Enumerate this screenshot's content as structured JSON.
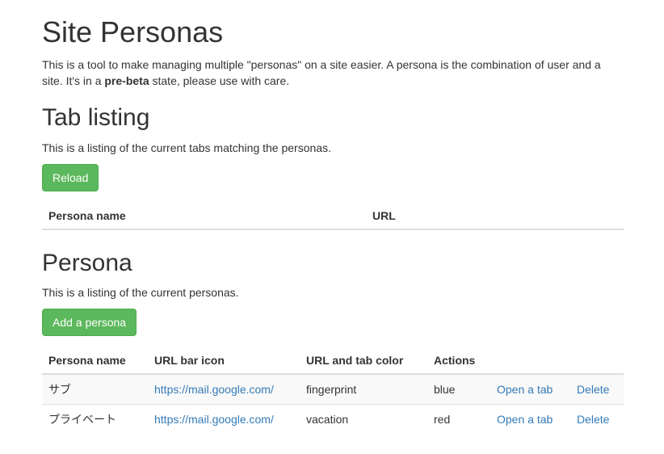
{
  "page": {
    "title": "Site Personas",
    "intro_text_1": "This is a tool to make managing multiple \"personas\" on a site easier. A persona is the combination of user and a site. It's in a ",
    "intro_bold": "pre-beta",
    "intro_text_2": " state, please use with care."
  },
  "tab_listing": {
    "heading": "Tab listing",
    "description": "This is a listing of the current tabs matching the personas.",
    "reload_label": "Reload",
    "columns": [
      "Persona name",
      "URL"
    ]
  },
  "persona": {
    "heading": "Persona",
    "description": "This is a listing of the current personas.",
    "add_label": "Add a persona",
    "columns": [
      "Persona name",
      "URL bar icon",
      "URL and tab color",
      "Actions"
    ],
    "rows": [
      {
        "name": "サブ",
        "url": "https://mail.google.com/",
        "icon": "fingerprint",
        "color": "blue",
        "open_label": "Open a tab",
        "delete_label": "Delete"
      },
      {
        "name": "プライベート",
        "url": "https://mail.google.com/",
        "icon": "vacation",
        "color": "red",
        "open_label": "Open a tab",
        "delete_label": "Delete"
      }
    ]
  },
  "colors": {
    "success": "#5cb85c",
    "link": "#337ab7",
    "text": "#333333",
    "border": "#dddddd"
  }
}
